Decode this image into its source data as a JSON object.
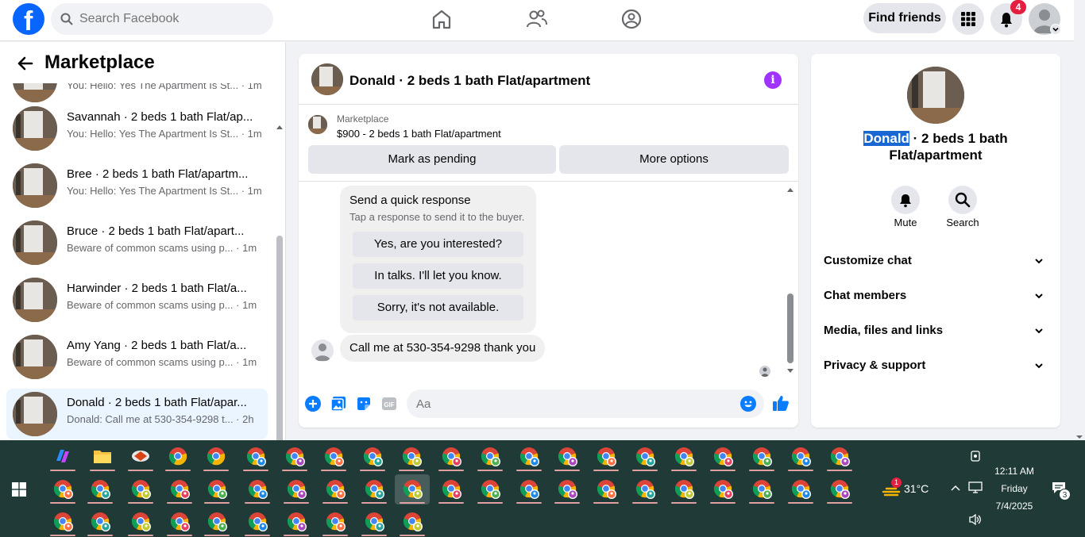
{
  "topbar": {
    "search_placeholder": "Search Facebook",
    "find_friends": "Find friends",
    "notifications_count": "4"
  },
  "sidebar": {
    "title": "Marketplace",
    "partial_item_sub": "You: Hello: Yes The Apartment Is St... · 1m",
    "conversations": [
      {
        "title": "Savannah · 2 beds 1 bath Flat/ap...",
        "subtitle": "You: Hello: Yes The Apartment Is St... · 1m"
      },
      {
        "title": "Bree · 2 beds 1 bath Flat/apartm...",
        "subtitle": "You: Hello: Yes The Apartment Is St... · 1m"
      },
      {
        "title": "Bruce · 2 beds 1 bath Flat/apart...",
        "subtitle": "Beware of common scams using p... · 1m"
      },
      {
        "title": "Harwinder · 2 beds 1 bath Flat/a...",
        "subtitle": "Beware of common scams using p... · 1m"
      },
      {
        "title": "Amy Yang · 2 beds 1 bath Flat/a...",
        "subtitle": "Beware of common scams using p... · 1m"
      },
      {
        "title": "Donald · 2 beds 1 bath Flat/apar...",
        "subtitle": "Donald: Call me at 530-354-9298 t... · 2h"
      }
    ]
  },
  "chat": {
    "title": "Donald · 2 beds 1 bath Flat/apartment",
    "listing_category": "Marketplace",
    "listing_price_title": "$900 - 2 beds 1 bath Flat/apartment",
    "mark_pending": "Mark as pending",
    "more_options": "More options",
    "quick_response_title": "Send a quick response",
    "quick_response_sub": "Tap a response to send it to the buyer.",
    "quick_responses": [
      "Yes, are you interested?",
      "In talks. I'll let you know.",
      "Sorry, it's not available."
    ],
    "message": "Call me at 530-354-9298 thank you",
    "composer_placeholder": "Aa",
    "gif_label": "GIF"
  },
  "right_panel": {
    "name_highlight": "Donald",
    "name_rest": " · 2 beds 1 bath Flat/apartment",
    "mute": "Mute",
    "search": "Search",
    "sections": [
      "Customize chat",
      "Chat members",
      "Media, files and links",
      "Privacy & support"
    ]
  },
  "taskbar": {
    "temperature": "31°C",
    "weather_badge": "1",
    "time": "12:11 AM",
    "day": "Friday",
    "date": "7/4/2025",
    "notif_count": "3"
  },
  "colors": {
    "facebook_blue": "#0866ff",
    "messenger_blue": "#0a7cff",
    "info_purple": "#a033ff",
    "badge_red": "#e41e3f",
    "taskbar_bg": "#1f3a37"
  }
}
